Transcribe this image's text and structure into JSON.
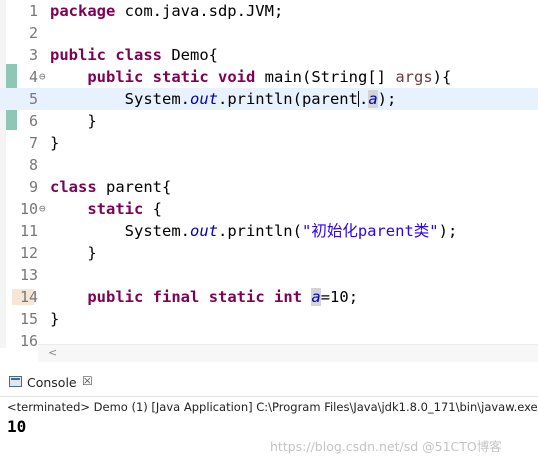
{
  "editor": {
    "lines": [
      {
        "num": "1",
        "tokens": [
          {
            "t": "package",
            "c": "kw"
          },
          {
            "t": " com.java.sdp.JVM;",
            "c": ""
          }
        ]
      },
      {
        "num": "2",
        "tokens": []
      },
      {
        "num": "3",
        "tokens": [
          {
            "t": "public",
            "c": "kw"
          },
          {
            "t": " ",
            "c": ""
          },
          {
            "t": "class",
            "c": "kw"
          },
          {
            "t": " Demo{",
            "c": ""
          }
        ]
      },
      {
        "num": "4",
        "fold": "⊖",
        "tokens": [
          {
            "t": "    ",
            "c": ""
          },
          {
            "t": "public",
            "c": "kw"
          },
          {
            "t": " ",
            "c": ""
          },
          {
            "t": "static",
            "c": "kw"
          },
          {
            "t": " ",
            "c": ""
          },
          {
            "t": "void",
            "c": "kw"
          },
          {
            "t": " main(String[] ",
            "c": ""
          },
          {
            "t": "args",
            "c": "var"
          },
          {
            "t": "){",
            "c": ""
          }
        ]
      },
      {
        "num": "5",
        "current": true,
        "tokens": [
          {
            "t": "        System.",
            "c": ""
          },
          {
            "t": "out",
            "c": "field"
          },
          {
            "t": ".println(parent",
            "c": ""
          },
          {
            "t": "",
            "c": "caret"
          },
          {
            "t": ".",
            "c": ""
          },
          {
            "t": "a",
            "c": "field occ"
          },
          {
            "t": ");",
            "c": ""
          }
        ]
      },
      {
        "num": "6",
        "tokens": [
          {
            "t": "    }",
            "c": ""
          }
        ]
      },
      {
        "num": "7",
        "tokens": [
          {
            "t": "}",
            "c": ""
          }
        ]
      },
      {
        "num": "8",
        "tokens": []
      },
      {
        "num": "9",
        "tokens": [
          {
            "t": "class",
            "c": "kw"
          },
          {
            "t": " parent{",
            "c": ""
          }
        ]
      },
      {
        "num": "10",
        "fold": "⊖",
        "tokens": [
          {
            "t": "    ",
            "c": ""
          },
          {
            "t": "static",
            "c": "kw"
          },
          {
            "t": " {",
            "c": ""
          }
        ]
      },
      {
        "num": "11",
        "tokens": [
          {
            "t": "        System.",
            "c": ""
          },
          {
            "t": "out",
            "c": "field"
          },
          {
            "t": ".println(",
            "c": ""
          },
          {
            "t": "\"初始化parent类\"",
            "c": "str"
          },
          {
            "t": ");",
            "c": ""
          }
        ]
      },
      {
        "num": "12",
        "tokens": [
          {
            "t": "    }",
            "c": ""
          }
        ]
      },
      {
        "num": "13",
        "tokens": []
      },
      {
        "num": "14",
        "occurrence": true,
        "tokens": [
          {
            "t": "    ",
            "c": ""
          },
          {
            "t": "public",
            "c": "kw"
          },
          {
            "t": " ",
            "c": ""
          },
          {
            "t": "final",
            "c": "kw"
          },
          {
            "t": " ",
            "c": ""
          },
          {
            "t": "static",
            "c": "kw"
          },
          {
            "t": " ",
            "c": ""
          },
          {
            "t": "int",
            "c": "kw"
          },
          {
            "t": " ",
            "c": ""
          },
          {
            "t": "a",
            "c": "field occ"
          },
          {
            "t": "=10;",
            "c": ""
          }
        ]
      },
      {
        "num": "15",
        "tokens": [
          {
            "t": "}",
            "c": ""
          }
        ]
      },
      {
        "num": "16",
        "tokens": []
      }
    ]
  },
  "console": {
    "tab_label": "Console",
    "close_glyph": "☒",
    "status": "<terminated> Demo (1) [Java Application] C:\\Program Files\\Java\\jdk1.8.0_171\\bin\\javaw.exe",
    "output": "10"
  },
  "scroll_arrow": "<",
  "watermark": "https://blog.csdn.net/sd @51CTO博客"
}
